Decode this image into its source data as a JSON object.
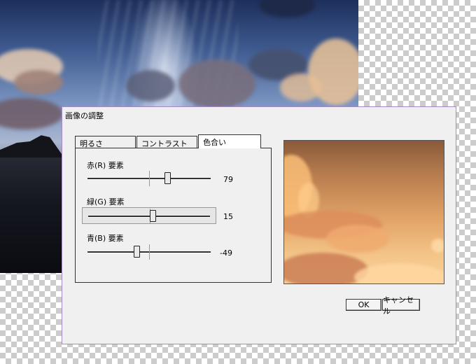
{
  "dialog": {
    "title": "画像の調整",
    "tabs": [
      {
        "label": "明るさ",
        "active": false
      },
      {
        "label": "コントラスト",
        "active": false
      },
      {
        "label": "色合い",
        "active": true
      }
    ],
    "sliders": [
      {
        "label": "赤(R) 要素",
        "value": "79",
        "selected": false
      },
      {
        "label": "緑(G) 要素",
        "value": "15",
        "selected": true
      },
      {
        "label": "青(B) 要素",
        "value": "-49",
        "selected": false
      }
    ],
    "buttons": {
      "ok": "OK",
      "cancel": "キャンセル"
    }
  },
  "colors": {
    "dialog_border": "#a58bc3",
    "dialog_bg": "#f0f0f0",
    "checkerboard": "#cccccc"
  }
}
